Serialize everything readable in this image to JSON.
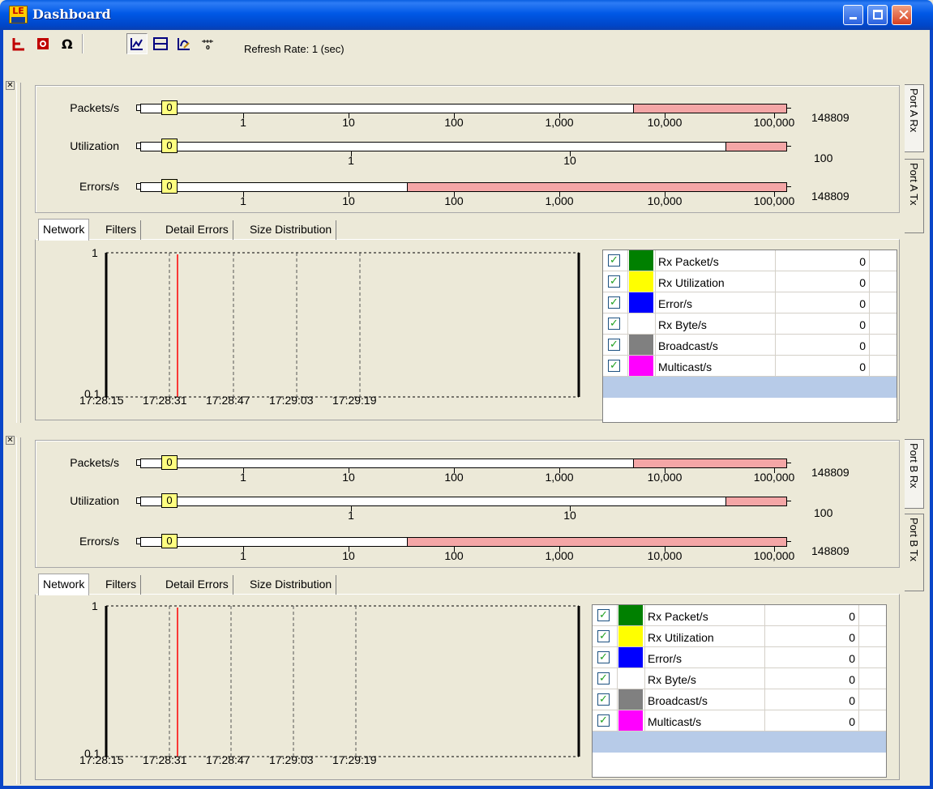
{
  "window": {
    "title": "Dashboard",
    "icon_text": "LE"
  },
  "toolbar": {
    "buttons": [
      "port-layout-icon",
      "record-icon",
      "ohm-icon",
      "line-chart-icon",
      "split-view-icon",
      "graph-settings-icon",
      "threshold-icon"
    ],
    "refresh_label": "Refresh Rate: 1 (sec)"
  },
  "panels": [
    {
      "id": "port-a",
      "vertical_tabs": [
        "Port A Rx",
        "Port A Tx"
      ],
      "meters": [
        {
          "label": "Packets/s",
          "value": "0",
          "max": "148809",
          "ticks": [
            "1",
            "10",
            "100",
            "1,000",
            "10,000",
            "100,000"
          ],
          "red_from_fraction": 0.762
        },
        {
          "label": "Utilization",
          "value": "0",
          "max": "100",
          "ticks": [
            "1",
            "10"
          ],
          "red_from_fraction": 0.905
        },
        {
          "label": "Errors/s",
          "value": "0",
          "max": "148809",
          "ticks": [
            "1",
            "10",
            "100",
            "1,000",
            "10,000",
            "100,000"
          ],
          "red_from_fraction": 0.412
        }
      ],
      "tabs": [
        "Network",
        "Filters",
        "Detail Errors",
        "Size Distribution"
      ],
      "active_tab": "Network",
      "chart": {
        "y_top": "1",
        "y_bottom": "0.1",
        "x_labels": [
          "17:28:15",
          "17:28:31",
          "17:28:47",
          "17:29:03",
          "17:29:19"
        ]
      },
      "legend": [
        {
          "name": "Rx Packet/s",
          "color": "#008000",
          "value": "0",
          "checked": true
        },
        {
          "name": "Rx Utilization",
          "color": "#ffff00",
          "value": "0",
          "checked": true
        },
        {
          "name": "Error/s",
          "color": "#0000ff",
          "value": "0",
          "checked": true
        },
        {
          "name": "Rx Byte/s",
          "color": "#ffffff",
          "value": "0",
          "checked": true
        },
        {
          "name": "Broadcast/s",
          "color": "#808080",
          "value": "0",
          "checked": true
        },
        {
          "name": "Multicast/s",
          "color": "#ff00ff",
          "value": "0",
          "checked": true
        }
      ]
    },
    {
      "id": "port-b",
      "vertical_tabs": [
        "Port B Rx",
        "Port B Tx"
      ],
      "meters": [
        {
          "label": "Packets/s",
          "value": "0",
          "max": "148809",
          "ticks": [
            "1",
            "10",
            "100",
            "1,000",
            "10,000",
            "100,000"
          ],
          "red_from_fraction": 0.762
        },
        {
          "label": "Utilization",
          "value": "0",
          "max": "100",
          "ticks": [
            "1",
            "10"
          ],
          "red_from_fraction": 0.905
        },
        {
          "label": "Errors/s",
          "value": "0",
          "max": "148809",
          "ticks": [
            "1",
            "10",
            "100",
            "1,000",
            "10,000",
            "100,000"
          ],
          "red_from_fraction": 0.412
        }
      ],
      "tabs": [
        "Network",
        "Filters",
        "Detail Errors",
        "Size Distribution"
      ],
      "active_tab": "Network",
      "chart": {
        "y_top": "1",
        "y_bottom": "0.1",
        "x_labels": [
          "17:28:15",
          "17:28:31",
          "17:28:47",
          "17:29:03",
          "17:29:19"
        ]
      },
      "legend": [
        {
          "name": "Rx Packet/s",
          "color": "#008000",
          "value": "0",
          "checked": true
        },
        {
          "name": "Rx Utilization",
          "color": "#ffff00",
          "value": "0",
          "checked": true
        },
        {
          "name": "Error/s",
          "color": "#0000ff",
          "value": "0",
          "checked": true
        },
        {
          "name": "Rx Byte/s",
          "color": "#ffffff",
          "value": "0",
          "checked": true
        },
        {
          "name": "Broadcast/s",
          "color": "#808080",
          "value": "0",
          "checked": true
        },
        {
          "name": "Multicast/s",
          "color": "#ff00ff",
          "value": "0",
          "checked": true
        }
      ]
    }
  ],
  "colors": {
    "titlebar": "#0058e6",
    "face": "#ece9d8",
    "meter_red": "#f4a6a6",
    "knob": "#ffff80",
    "legend_blank_row": "#b7cbe8",
    "chart_cursor": "#ff0000"
  }
}
